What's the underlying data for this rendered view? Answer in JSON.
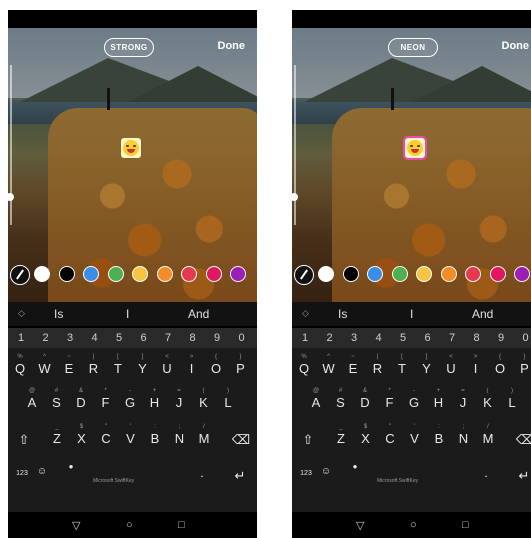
{
  "screens": [
    {
      "style_chip": "STRONG",
      "done_label": "Done",
      "emoji_selected": false
    },
    {
      "style_chip": "NEON",
      "done_label": "Done",
      "emoji_selected": true
    }
  ],
  "colors": [
    "#ffffff",
    "#000000",
    "#3a8ee6",
    "#4caf50",
    "#f5c542",
    "#f28c28",
    "#e53950",
    "#e0185f",
    "#9c1eb3"
  ],
  "suggestions": [
    "Is",
    "I",
    "And"
  ],
  "number_row": [
    "1",
    "2",
    "3",
    "4",
    "5",
    "6",
    "7",
    "8",
    "9",
    "0"
  ],
  "row1": [
    {
      "k": "Q",
      "a": "%"
    },
    {
      "k": "W",
      "a": "^"
    },
    {
      "k": "E",
      "a": "~"
    },
    {
      "k": "R",
      "a": "|"
    },
    {
      "k": "T",
      "a": "["
    },
    {
      "k": "Y",
      "a": "]"
    },
    {
      "k": "U",
      "a": "<"
    },
    {
      "k": "I",
      "a": ">"
    },
    {
      "k": "O",
      "a": "{"
    },
    {
      "k": "P",
      "a": "}"
    }
  ],
  "row2": [
    {
      "k": "A",
      "a": "@"
    },
    {
      "k": "S",
      "a": "#"
    },
    {
      "k": "D",
      "a": "&"
    },
    {
      "k": "F",
      "a": "*"
    },
    {
      "k": "G",
      "a": "-"
    },
    {
      "k": "H",
      "a": "+"
    },
    {
      "k": "J",
      "a": "="
    },
    {
      "k": "K",
      "a": "("
    },
    {
      "k": "L",
      "a": ")"
    }
  ],
  "row3": [
    {
      "k": "Z",
      "a": "_"
    },
    {
      "k": "X",
      "a": "$"
    },
    {
      "k": "C",
      "a": "\""
    },
    {
      "k": "V",
      "a": "'"
    },
    {
      "k": "B",
      "a": ":"
    },
    {
      "k": "N",
      "a": ";"
    },
    {
      "k": "M",
      "a": "/"
    }
  ],
  "bottom": {
    "mode": "123",
    "brand": "Microsoft SwiftKey",
    "period": "."
  },
  "icons": {
    "shift": "shift-icon",
    "backspace": "backspace-icon",
    "emoji": "emoji-icon",
    "mic": "mic-icon",
    "enter": "enter-icon",
    "pen": "pen-icon",
    "back": "nav-back-icon",
    "home": "nav-home-icon",
    "recent": "nav-recent-icon"
  }
}
